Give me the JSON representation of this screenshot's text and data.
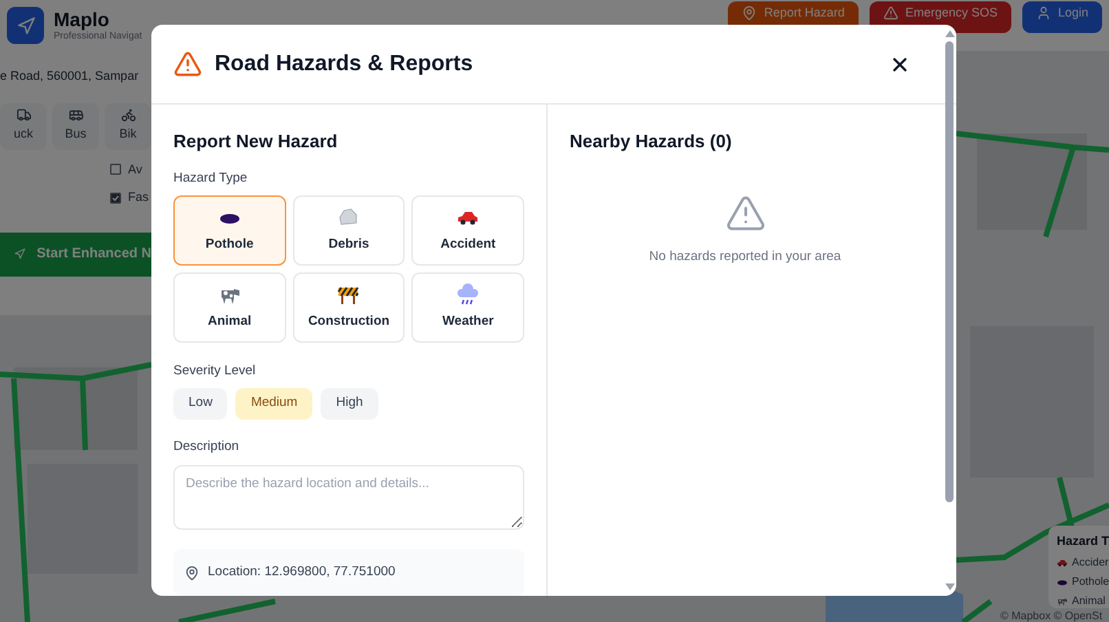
{
  "app": {
    "name": "Maplo",
    "tagline": "Professional Navigat"
  },
  "header_buttons": [
    {
      "label": "Report Hazard",
      "kind": "report"
    },
    {
      "label": "Emergency SOS",
      "kind": "sos"
    },
    {
      "label": "Login",
      "kind": "login"
    }
  ],
  "sidebar": {
    "address": "e Road, 560001, Sampar",
    "vehicles": [
      {
        "label": "uck",
        "kind": "truck"
      },
      {
        "label": "Bus",
        "kind": "bus"
      },
      {
        "label": "Bik",
        "kind": "bike"
      }
    ],
    "options": [
      {
        "label": "Av",
        "checked": false
      },
      {
        "label": "Fas",
        "checked": true
      }
    ],
    "start_button": "Start Enhanced N"
  },
  "legend": {
    "title": "Hazard T",
    "items": [
      {
        "label": "Accider",
        "kind": "accident"
      },
      {
        "label": "Pothole",
        "kind": "pothole"
      },
      {
        "label": "Animal",
        "kind": "animal"
      }
    ]
  },
  "attribution": "© Mapbox © OpenSt",
  "modal": {
    "title": "Road Hazards & Reports",
    "report": {
      "heading": "Report New Hazard",
      "hazard_type_label": "Hazard Type",
      "hazard_types": [
        {
          "label": "Pothole",
          "kind": "pothole",
          "selected": true
        },
        {
          "label": "Debris",
          "kind": "debris",
          "selected": false
        },
        {
          "label": "Accident",
          "kind": "accident",
          "selected": false
        },
        {
          "label": "Animal",
          "kind": "animal",
          "selected": false
        },
        {
          "label": "Construction",
          "kind": "construction",
          "selected": false
        },
        {
          "label": "Weather",
          "kind": "weather",
          "selected": false
        }
      ],
      "severity_label": "Severity Level",
      "severities": [
        {
          "label": "Low",
          "kind": "low",
          "selected": false
        },
        {
          "label": "Medium",
          "kind": "medium",
          "selected": true
        },
        {
          "label": "High",
          "kind": "high",
          "selected": false
        }
      ],
      "description_label": "Description",
      "description_placeholder": "Describe the hazard location and details...",
      "location": "Location: 12.969800, 77.751000"
    },
    "nearby": {
      "heading": "Nearby Hazards (0)",
      "empty_text": "No hazards reported in your area"
    }
  }
}
